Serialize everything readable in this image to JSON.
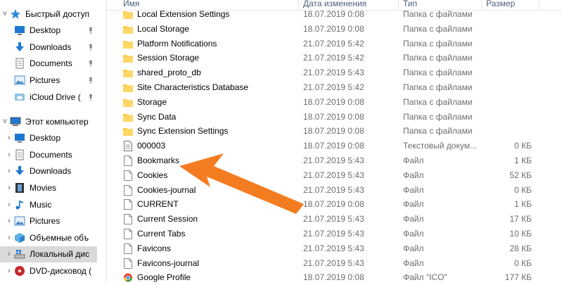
{
  "colors": {
    "folder": "#ffc83d",
    "arrow": "#f47c20",
    "selected": "#d9d9d9",
    "header_text": "#4c607a"
  },
  "nav": {
    "items": [
      {
        "label": "Быстрый доступ",
        "icon": "star-icon",
        "chevron": "˅",
        "indent": 0,
        "pinned": false
      },
      {
        "label": "Desktop",
        "icon": "desktop-icon",
        "chevron": "",
        "indent": 1,
        "pinned": true
      },
      {
        "label": "Downloads",
        "icon": "download-icon",
        "chevron": "",
        "indent": 1,
        "pinned": true
      },
      {
        "label": "Documents",
        "icon": "documents-icon",
        "chevron": "",
        "indent": 1,
        "pinned": true
      },
      {
        "label": "Pictures",
        "icon": "pictures-icon",
        "chevron": "",
        "indent": 1,
        "pinned": true
      },
      {
        "label": "iCloud Drive (",
        "icon": "icloud-icon",
        "chevron": "",
        "indent": 1,
        "pinned": true
      },
      {
        "label": "Этот компьютер",
        "icon": "computer-icon",
        "chevron": "˅",
        "indent": 0,
        "pinned": false
      },
      {
        "label": "Desktop",
        "icon": "desktop-icon",
        "chevron": "›",
        "indent": 1,
        "pinned": false
      },
      {
        "label": "Documents",
        "icon": "documents-icon",
        "chevron": "›",
        "indent": 1,
        "pinned": false
      },
      {
        "label": "Downloads",
        "icon": "download-icon",
        "chevron": "›",
        "indent": 1,
        "pinned": false
      },
      {
        "label": "Movies",
        "icon": "movies-icon",
        "chevron": "›",
        "indent": 1,
        "pinned": false
      },
      {
        "label": "Music",
        "icon": "music-icon",
        "chevron": "›",
        "indent": 1,
        "pinned": false
      },
      {
        "label": "Pictures",
        "icon": "pictures-icon",
        "chevron": "›",
        "indent": 1,
        "pinned": false
      },
      {
        "label": "Объемные объ",
        "icon": "3d-objects-icon",
        "chevron": "›",
        "indent": 1,
        "pinned": false
      },
      {
        "label": "Локальный дис",
        "icon": "local-disk-icon",
        "chevron": "›",
        "indent": 1,
        "pinned": false,
        "selected": true
      },
      {
        "label": "DVD-дисковод (",
        "icon": "dvd-drive-icon",
        "chevron": "›",
        "indent": 1,
        "pinned": false
      }
    ]
  },
  "columns": {
    "name": "Имя",
    "date": "Дата изменения",
    "type": "Тип",
    "size": "Размер"
  },
  "files": [
    {
      "name": "Local Extension Settings",
      "date": "18.07.2019 0:08",
      "type": "Папка с файлами",
      "size": "",
      "kind": "folder"
    },
    {
      "name": "Local Storage",
      "date": "18.07.2019 0:08",
      "type": "Папка с файлами",
      "size": "",
      "kind": "folder"
    },
    {
      "name": "Platform Notifications",
      "date": "21.07.2019 5:42",
      "type": "Папка с файлами",
      "size": "",
      "kind": "folder"
    },
    {
      "name": "Session Storage",
      "date": "21.07.2019 5:42",
      "type": "Папка с файлами",
      "size": "",
      "kind": "folder"
    },
    {
      "name": "shared_proto_db",
      "date": "21.07.2019 5:43",
      "type": "Папка с файлами",
      "size": "",
      "kind": "folder"
    },
    {
      "name": "Site Characteristics Database",
      "date": "21.07.2019 5:42",
      "type": "Папка с файлами",
      "size": "",
      "kind": "folder"
    },
    {
      "name": "Storage",
      "date": "18.07.2019 0:08",
      "type": "Папка с файлами",
      "size": "",
      "kind": "folder"
    },
    {
      "name": "Sync Data",
      "date": "18.07.2019 0:08",
      "type": "Папка с файлами",
      "size": "",
      "kind": "folder"
    },
    {
      "name": "Sync Extension Settings",
      "date": "18.07.2019 0:08",
      "type": "Папка с файлами",
      "size": "",
      "kind": "folder"
    },
    {
      "name": "000003",
      "date": "18.07.2019 0:08",
      "type": "Текстовый докум...",
      "size": "0 КБ",
      "kind": "text"
    },
    {
      "name": "Bookmarks",
      "date": "21.07.2019 5:43",
      "type": "Файл",
      "size": "1 КБ",
      "kind": "file"
    },
    {
      "name": "Cookies",
      "date": "21.07.2019 5:43",
      "type": "Файл",
      "size": "52 КБ",
      "kind": "file"
    },
    {
      "name": "Cookies-journal",
      "date": "21.07.2019 5:43",
      "type": "Файл",
      "size": "0 КБ",
      "kind": "file"
    },
    {
      "name": "CURRENT",
      "date": "18.07.2019 0:08",
      "type": "Файл",
      "size": "1 КБ",
      "kind": "file"
    },
    {
      "name": "Current Session",
      "date": "21.07.2019 5:43",
      "type": "Файл",
      "size": "17 КБ",
      "kind": "file"
    },
    {
      "name": "Current Tabs",
      "date": "21.07.2019 5:43",
      "type": "Файл",
      "size": "10 КБ",
      "kind": "file"
    },
    {
      "name": "Favicons",
      "date": "21.07.2019 5:43",
      "type": "Файл",
      "size": "28 КБ",
      "kind": "file"
    },
    {
      "name": "Favicons-journal",
      "date": "21.07.2019 5:43",
      "type": "Файл",
      "size": "0 КБ",
      "kind": "file"
    },
    {
      "name": "Google Profile",
      "date": "18.07.2019 0:08",
      "type": "Файл \"ICO\"",
      "size": "177 КБ",
      "kind": "ico"
    }
  ]
}
